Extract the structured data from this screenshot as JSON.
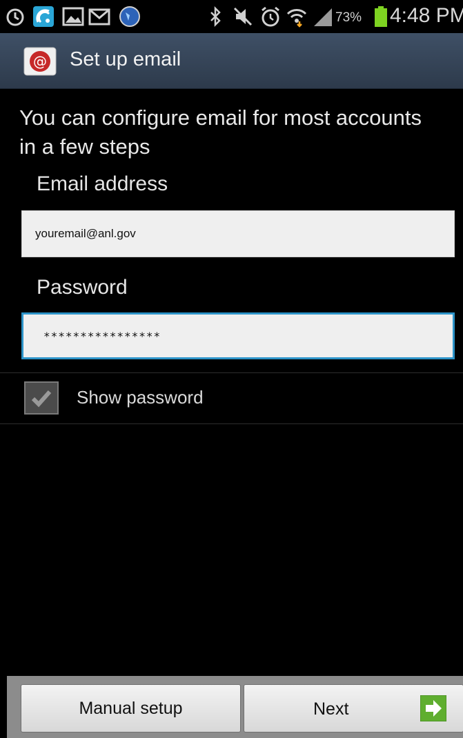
{
  "status_bar": {
    "icons": [
      "alarm-icon",
      "wifi-calling-icon",
      "gallery-icon",
      "gmail-icon",
      "globe-icon",
      "bluetooth-icon",
      "mute-icon",
      "alarm-clock-icon",
      "wifi-icon",
      "signal-icon",
      "battery-icon"
    ],
    "battery_percent": "73%",
    "time": "4:48 PM",
    "battery_color": "#7ed321"
  },
  "action_bar": {
    "title": "Set up email",
    "icon": "email-app-icon",
    "background": "#3a4a5e"
  },
  "form": {
    "intro": "You can configure email for most accounts in a few steps",
    "email_label": "Email address",
    "email_value": "youremail@anl.gov",
    "password_label": "Password",
    "password_value": "****************",
    "show_password_label": "Show password",
    "show_password_checked": true,
    "focus_color": "#2c93c8"
  },
  "buttons": {
    "manual_setup": "Manual setup",
    "next": "Next",
    "next_icon": "next-arrow-icon"
  }
}
